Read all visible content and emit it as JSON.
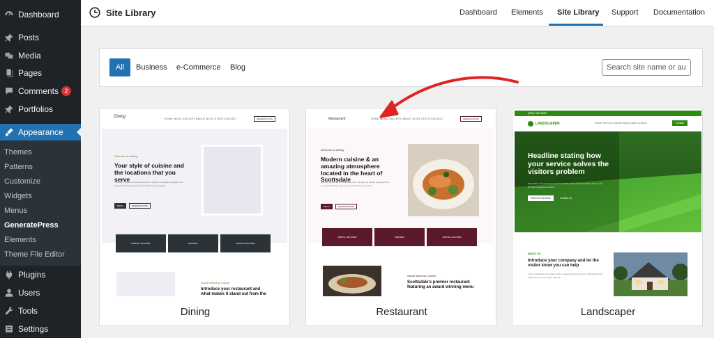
{
  "sidebar": {
    "items": [
      {
        "label": "Dashboard",
        "icon": "dashboard-icon"
      },
      {
        "label": "Posts",
        "icon": "pin-icon"
      },
      {
        "label": "Media",
        "icon": "media-icon"
      },
      {
        "label": "Pages",
        "icon": "pages-icon"
      },
      {
        "label": "Comments",
        "icon": "comment-icon",
        "badge": "2"
      },
      {
        "label": "Portfolios",
        "icon": "pin-icon"
      },
      {
        "label": "Appearance",
        "icon": "brush-icon"
      },
      {
        "label": "Plugins",
        "icon": "plugin-icon"
      },
      {
        "label": "Users",
        "icon": "user-icon"
      },
      {
        "label": "Tools",
        "icon": "wrench-icon"
      },
      {
        "label": "Settings",
        "icon": "settings-icon"
      }
    ],
    "submenu": [
      "Themes",
      "Patterns",
      "Customize",
      "Widgets",
      "Menus",
      "GeneratePress",
      "Elements",
      "Theme File Editor"
    ]
  },
  "header": {
    "title": "Site Library",
    "nav": [
      "Dashboard",
      "Elements",
      "Site Library",
      "Support",
      "Documentation"
    ]
  },
  "filters": {
    "chips": [
      "All",
      "Business",
      "e-Commerce",
      "Blog"
    ],
    "search_placeholder": "Search site name or au"
  },
  "cards": [
    {
      "name": "Dining",
      "logo": "Dining",
      "nav": "HOME   MENU   GALLERY   ABOUT   BLOG   STATS   CONTACT",
      "cta": "RESERVATIONS",
      "welcome": "Welcome to Dining",
      "headline": "Your style of cuisine and the locations that you serve",
      "body": "This text is here as a visual reference to display the default paragraph font. A second sentence goes here to show the line spacing.",
      "btn1": "MENU",
      "btn2": "RESERVATIONS",
      "locations": [
        "NORTH LOCATION",
        "CENTRAL",
        "SOUTH LOCATION"
      ],
      "award": "Award Winning Cuisine",
      "bottom": "Introduce your restaurant and what makes it stand out from the rest"
    },
    {
      "name": "Restaurant",
      "logo": "Restaurant",
      "nav": "HOME   MENU   GALLERY   ABOUT   BLOG   STATS   CONTACT",
      "cta": "RESERVATIONS",
      "welcome": "Welcome to Dining",
      "headline": "Modern cuisine & an amazing atmosphere located in the heart of Scottsdale",
      "body": "This text is here as a visual reference to display the default paragraph font. A second sentence goes here to show the line spacing.",
      "btn1": "MENU",
      "btn2": "RESERVATIONS",
      "locations": [
        "NORTH LOCATION",
        "CENTRAL",
        "SOUTH LOCATION"
      ],
      "award": "Award Winning Cuisine",
      "bottom": "Scottsdale's premier restaurant featuring an award winning menu"
    },
    {
      "name": "Landscaper",
      "logo": "LANDSCAPER",
      "phone": "(555) 555-5555",
      "nav": "Home   Services   About   Blog   Stats   Contact",
      "cta": "Contact",
      "headline": "Headline stating how your service solves the visitors problem",
      "body": "Summarize how your service can benefit the visitor and assure them that you are the right company to contact.",
      "btn1": "View Our Services",
      "btn2": "Contact Us",
      "about_label": "ABOUT US",
      "about_headline": "Introduce your company and let the visitor know you can help",
      "about_body": "This is placeholder text which will be replaced with your content. Placeholder text helps show how the layout will look."
    }
  ],
  "colors": {
    "sidebar_bg": "#1d2327",
    "accent": "#2271b1",
    "restaurant_maroon": "#5a1a2b",
    "dining_dark": "#2c3338",
    "landscaper_green": "#2e8b12",
    "arrow_red": "#e02424"
  }
}
